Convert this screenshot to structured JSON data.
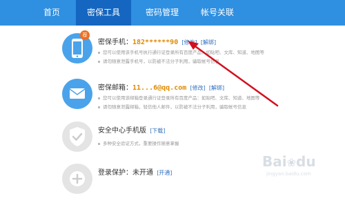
{
  "nav": {
    "tabs": [
      {
        "label": "首页"
      },
      {
        "label": "密保工具"
      },
      {
        "label": "密码管理"
      },
      {
        "label": "帐号关联"
      }
    ]
  },
  "items": {
    "phone": {
      "badge": "荐",
      "title": "密保手机：",
      "value": "182******90",
      "action1": "[修改]",
      "action2": "[解绑]",
      "line1": "您可以使用该手机号执行通行证登录所有百度产品：如贴吧、文库、知道、地图等",
      "line2": "请勿随意泄露手机号，以防被不法分子利用，骗取帐号信息"
    },
    "email": {
      "title": "密保邮箱：",
      "value": "11...6@qq.com",
      "action1": "[修改]",
      "action2": "[解绑]",
      "line1": "您可以使用该邮箱登录通行证登录所有百度产品：如贴吧、文库、知道、地图等",
      "line2": "请勿随意泄露邮箱，轻信他人邮件，以防被不法分子利用，骗取帐号信息"
    },
    "app": {
      "title": "安全中心手机版",
      "action1": "[下载]",
      "line1": "多种安全验证方式，重要操作随意掌握"
    },
    "login": {
      "title": "登录保护：未开通",
      "action1": "[开通]"
    }
  },
  "colors": {
    "nav_bg": "#2f8fe0",
    "nav_active": "#1466c0",
    "value": "#e08a00",
    "link": "#2f6fc0",
    "arrow": "#d2101e"
  },
  "watermark": {
    "brand": "Bai",
    "brand2": "du",
    "sub": "jingyan.baidu.com"
  }
}
